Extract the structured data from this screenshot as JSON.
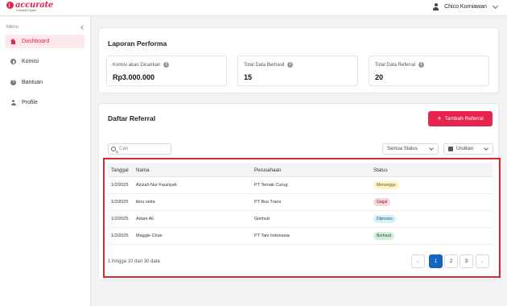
{
  "header": {
    "logo_text": "accurate",
    "logo_sub": "Connect Expert",
    "user_name": "Chico Kurniawan"
  },
  "sidebar": {
    "menu_label": "Menu",
    "items": [
      {
        "label": "Dashboard",
        "active": true
      },
      {
        "label": "Komisi"
      },
      {
        "label": "Bantuan"
      },
      {
        "label": "Profile"
      }
    ]
  },
  "performance": {
    "title": "Laporan Performa",
    "stats": [
      {
        "label": "Komisi akan Dicairkan",
        "value": "Rp3.000.000"
      },
      {
        "label": "Total Data Berhasil",
        "value": "15"
      },
      {
        "label": "Total Data Referral",
        "value": "20"
      }
    ]
  },
  "referral": {
    "title": "Daftar Referral",
    "add_button": "Tambah Referral",
    "search_placeholder": "Cari",
    "status_filter": "Semua Status",
    "sort_label": "Urutkan",
    "columns": [
      "Tanggal",
      "Nama",
      "Perusahaan",
      "Status"
    ],
    "rows": [
      {
        "date": "1/2/2025",
        "name": "Azizah Nur Fauziyah",
        "company": "PT Ternak Curug",
        "status": "Menunggu",
        "status_bg": "#fdf3c7",
        "status_fg": "#6b5a10"
      },
      {
        "date": "1/2/2025",
        "name": "ibnu setia",
        "company": "PT Bus Trans",
        "status": "Gagal",
        "status_bg": "#fbd5da",
        "status_fg": "#8a1f2d"
      },
      {
        "date": "1/2/2025",
        "name": "Adam Ali",
        "company": "Gimhub",
        "status": "Diproses",
        "status_bg": "#d6f0fa",
        "status_fg": "#155a73"
      },
      {
        "date": "1/2/2025",
        "name": "Maggie Chan",
        "company": "PT Tani Indonesia",
        "status": "Berhasil",
        "status_bg": "#d3ecdc",
        "status_fg": "#1d5c33"
      }
    ],
    "pagination_text": "1 hingga 10 dari 30 data",
    "pages": [
      "1",
      "2",
      "3"
    ],
    "current_page": "1"
  }
}
